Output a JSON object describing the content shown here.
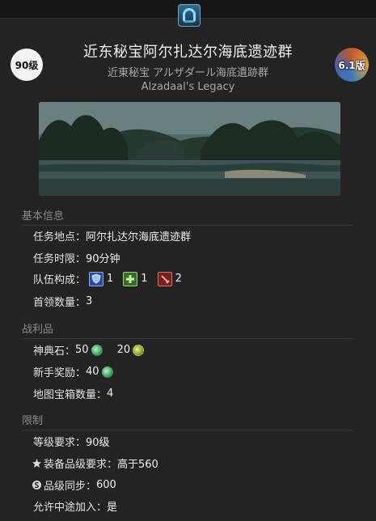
{
  "header": {
    "level_badge": "90级",
    "patch_badge": "6.1版",
    "title": "近东秘宝阿尔扎达尔海底遗迹群",
    "subtitle_ja": "近東秘宝 アルザダール海底遺跡群",
    "subtitle_en": "Alzadaal's Legacy",
    "duty_icon": "dungeon-portal-icon"
  },
  "banner": {
    "image": "underwater-ruins-island-scene"
  },
  "basic_info": {
    "heading": "基本信息",
    "location_label": "任务地点：",
    "location_value": "阿尔扎达尔海底遗迹群",
    "time_label": "任务时限：",
    "time_value": "90分钟",
    "party_label": "队伍构成：",
    "party": [
      {
        "role": "tank",
        "icon": "tank-shield-icon",
        "count": "1"
      },
      {
        "role": "healer",
        "icon": "healer-cross-icon",
        "count": "1"
      },
      {
        "role": "dps",
        "icon": "dps-sword-icon",
        "count": "2"
      }
    ],
    "boss_label": "首领数量：",
    "boss_value": "3"
  },
  "loot": {
    "heading": "战利品",
    "tomestone_label": "神典石：",
    "tomestone_green": "50",
    "tomestone_gold": "20",
    "rookie_label": "新手奖励：",
    "rookie_value": "40",
    "chest_label": "地图宝箱数量：",
    "chest_value": "4"
  },
  "limits": {
    "heading": "限制",
    "level_label": "等级要求：",
    "level_value": "90级",
    "ilvl_label": "装备品级要求：",
    "ilvl_value": "高于560",
    "sync_label": "品级同步：",
    "sync_value": "600",
    "join_label": "允许中途加入：",
    "join_value": "是"
  },
  "colors": {
    "background": "#232323",
    "section_heading": "#8a8a8a",
    "text": "#e2e2e2"
  }
}
